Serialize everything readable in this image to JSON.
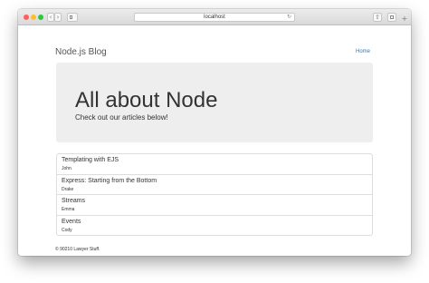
{
  "browser": {
    "address": "localhost",
    "nav_back_icon": "chevron-left-icon",
    "nav_forward_icon": "chevron-right-icon",
    "reload_icon": "reload-icon"
  },
  "site": {
    "brand": "Node.js Blog",
    "nav_home": "Home",
    "link_color": "#337ab7"
  },
  "jumbotron": {
    "title": "All about Node",
    "subtitle": "Check out our articles below!",
    "background": "#eeeeee"
  },
  "articles": [
    {
      "title": "Templating with EJS",
      "author": "John"
    },
    {
      "title": "Express: Starting from the Bottom",
      "author": "Drake"
    },
    {
      "title": "Streams",
      "author": "Emma"
    },
    {
      "title": "Events",
      "author": "Cody"
    }
  ],
  "footer": {
    "text": "© 90210 Lawyer Stuff."
  }
}
